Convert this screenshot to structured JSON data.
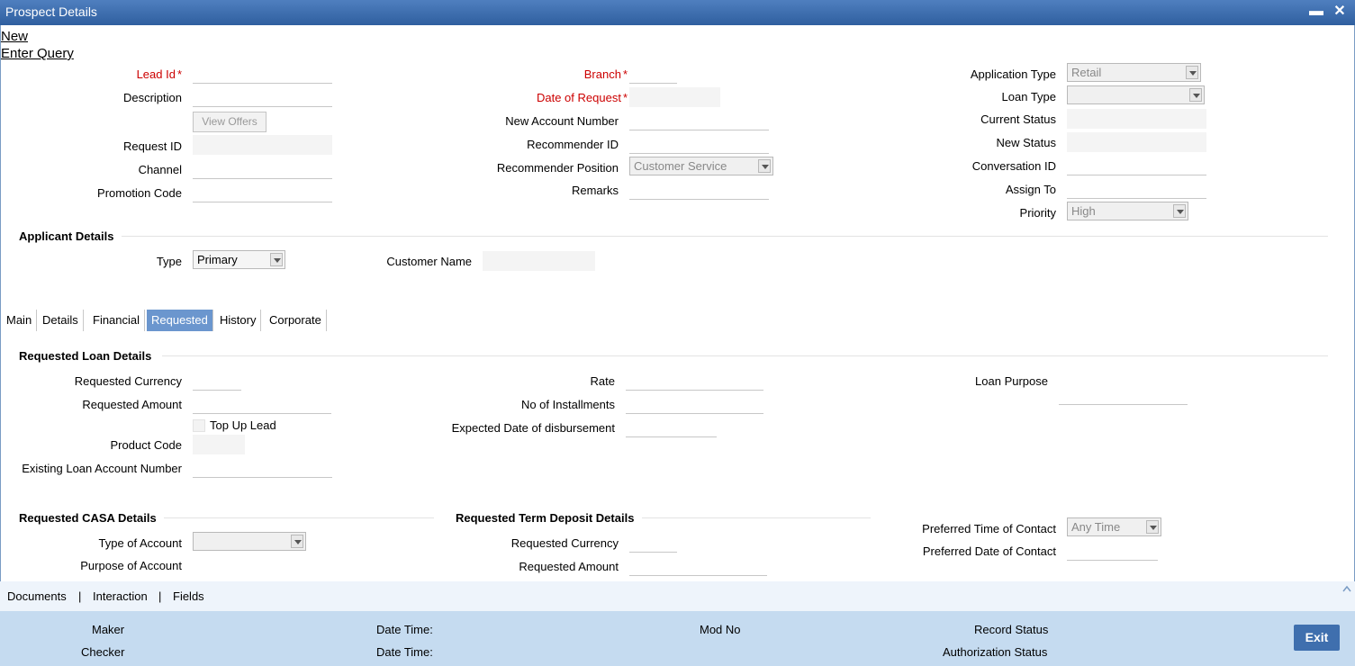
{
  "window": {
    "title": "Prospect Details"
  },
  "menu": {
    "new": "New",
    "enter_query": "Enter Query"
  },
  "header": {
    "lead_id": "Lead Id",
    "description": "Description",
    "view_offers": "View Offers",
    "request_id": "Request ID",
    "channel": "Channel",
    "promotion_code": "Promotion Code",
    "branch": "Branch",
    "date_of_request": "Date of Request",
    "new_account_number": "New Account Number",
    "recommender_id": "Recommender ID",
    "recommender_position": "Recommender Position",
    "recommender_position_value": "Customer Service",
    "remarks": "Remarks",
    "application_type": "Application Type",
    "application_type_value": "Retail",
    "loan_type": "Loan Type",
    "loan_type_value": "",
    "current_status": "Current Status",
    "new_status": "New Status",
    "conversation_id": "Conversation ID",
    "assign_to": "Assign To",
    "priority": "Priority",
    "priority_value": "High",
    "required_mark": "*"
  },
  "applicant": {
    "section": "Applicant Details",
    "type": "Type",
    "type_value": "Primary",
    "customer_name": "Customer Name"
  },
  "tabs": [
    "Main",
    "Details",
    "Financial",
    "Requested",
    "History",
    "Corporate"
  ],
  "active_tab": "Requested",
  "requested_loan": {
    "section": "Requested Loan Details",
    "requested_currency": "Requested Currency",
    "requested_amount": "Requested Amount",
    "top_up_lead": "Top Up Lead",
    "product_code": "Product Code",
    "existing_loan_account_number": "Existing Loan Account Number",
    "rate": "Rate",
    "no_of_installments": "No of Installments",
    "expected_date_of_disbursement": "Expected Date of disbursement",
    "loan_purpose": "Loan Purpose"
  },
  "casa": {
    "section": "Requested CASA Details",
    "type_of_account": "Type of Account",
    "type_of_account_value": "",
    "purpose_of_account": "Purpose of Account"
  },
  "term_deposit": {
    "section": "Requested Term Deposit Details",
    "requested_currency": "Requested Currency",
    "requested_amount": "Requested Amount"
  },
  "contact": {
    "preferred_time_of_contact": "Preferred Time of Contact",
    "preferred_time_value": "Any Time",
    "preferred_date_of_contact": "Preferred Date of Contact"
  },
  "bottom_links": {
    "documents": "Documents",
    "interaction": "Interaction",
    "fields": "Fields",
    "separator": "|"
  },
  "footer": {
    "maker": "Maker",
    "checker": "Checker",
    "date_time": "Date Time:",
    "mod_no": "Mod No",
    "record_status": "Record Status",
    "authorization_status": "Authorization Status",
    "exit": "Exit"
  },
  "colors": {
    "titlebar": "#2f5f9f",
    "active_tab": "#6b96ce",
    "footer": "#c5dbf0",
    "required": "#cc0000",
    "exit_button": "#3f6fae"
  }
}
